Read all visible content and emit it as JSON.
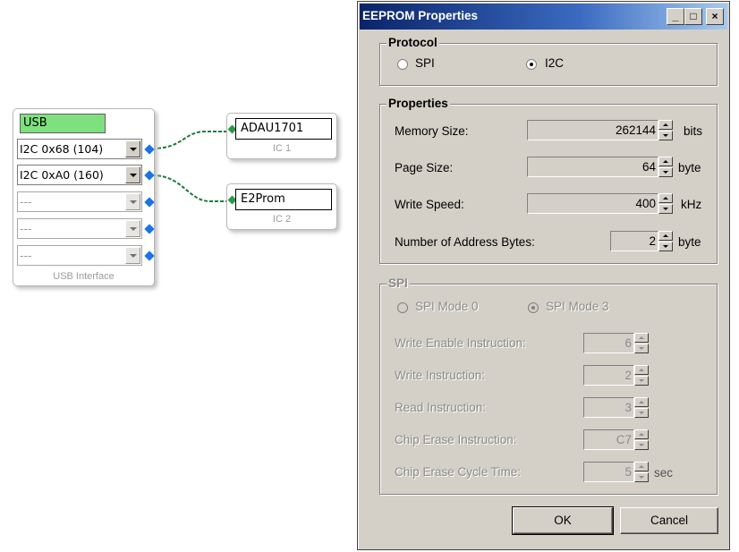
{
  "usb_interface": {
    "title": "USB",
    "rows": [
      {
        "label": "I2C 0x68 (104)",
        "enabled": true
      },
      {
        "label": "I2C 0xA0 (160)",
        "enabled": true
      },
      {
        "label": "---",
        "enabled": false
      },
      {
        "label": "---",
        "enabled": false
      },
      {
        "label": "---",
        "enabled": false
      }
    ],
    "caption": "USB Interface"
  },
  "ic1": {
    "name": "ADAU1701",
    "caption": "IC 1"
  },
  "ic2": {
    "name": "E2Prom",
    "caption": "IC 2"
  },
  "dialog": {
    "title": "EEPROM Properties",
    "titlebar_buttons": {
      "minimize": "_",
      "maximize": "□",
      "close": "×"
    },
    "protocol": {
      "label": "Protocol",
      "options": [
        {
          "label": "SPI",
          "checked": false
        },
        {
          "label": "I2C",
          "checked": true
        }
      ]
    },
    "properties": {
      "label": "Properties",
      "memory_size": {
        "label": "Memory Size:",
        "value": "262144",
        "unit": "bits"
      },
      "page_size": {
        "label": "Page Size:",
        "value": "64",
        "unit": "byte"
      },
      "write_speed": {
        "label": "Write Speed:",
        "value": "400",
        "unit": "kHz"
      },
      "address_bytes": {
        "label": "Number of Address Bytes:",
        "value": "2",
        "unit": "byte"
      }
    },
    "spi": {
      "label": "SPI",
      "modes": [
        {
          "label": "SPI Mode 0",
          "checked": false
        },
        {
          "label": "SPI Mode 3",
          "checked": true
        }
      ],
      "write_enable": {
        "label": "Write Enable Instruction:",
        "value": "6"
      },
      "write": {
        "label": "Write Instruction:",
        "value": "2"
      },
      "read": {
        "label": "Read Instruction:",
        "value": "3"
      },
      "chip_erase": {
        "label": "Chip Erase Instruction:",
        "value": "C7"
      },
      "chip_erase_cycle": {
        "label": "Chip Erase Cycle Time:",
        "value": "5",
        "unit": "sec"
      }
    },
    "ok_label": "OK",
    "cancel_label": "Cancel"
  }
}
